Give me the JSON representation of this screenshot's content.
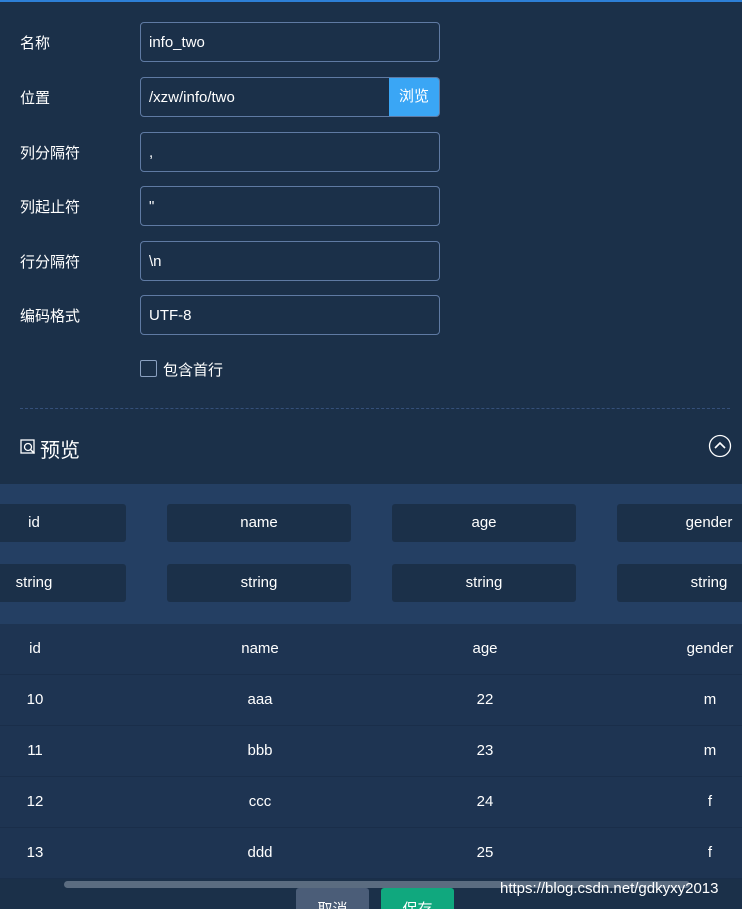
{
  "form": {
    "name_label": "名称",
    "name_value": "info_two",
    "location_label": "位置",
    "location_value": "/xzw/info/two",
    "browse_label": "浏览",
    "col_sep_label": "列分隔符",
    "col_sep_value": ",",
    "col_quote_label": "列起止符",
    "col_quote_value": "\"",
    "row_sep_label": "行分隔符",
    "row_sep_value": "\\n",
    "encoding_label": "编码格式",
    "encoding_value": "UTF-8",
    "include_header_label": "包含首行"
  },
  "preview": {
    "title": "预览",
    "icon": "preview-icon",
    "collapse_icon": "chevron-up-circle-icon"
  },
  "schema": {
    "names": [
      "id",
      "name",
      "age",
      "gender"
    ],
    "types": [
      "string",
      "string",
      "string",
      "string"
    ]
  },
  "table": {
    "headers": [
      "id",
      "name",
      "age",
      "gender"
    ],
    "rows": [
      [
        "10",
        "aaa",
        "22",
        "m"
      ],
      [
        "11",
        "bbb",
        "23",
        "m"
      ],
      [
        "12",
        "ccc",
        "24",
        "f"
      ],
      [
        "13",
        "ddd",
        "25",
        "f"
      ]
    ]
  },
  "footer": {
    "cancel_label": "取消",
    "save_label": "保存"
  },
  "watermark": "https://blog.csdn.net/gdkyxy2013",
  "colors": {
    "background": "#1b3049",
    "accent": "#3aa6f5",
    "save": "#10a87e",
    "cancel": "#4b5d78"
  }
}
